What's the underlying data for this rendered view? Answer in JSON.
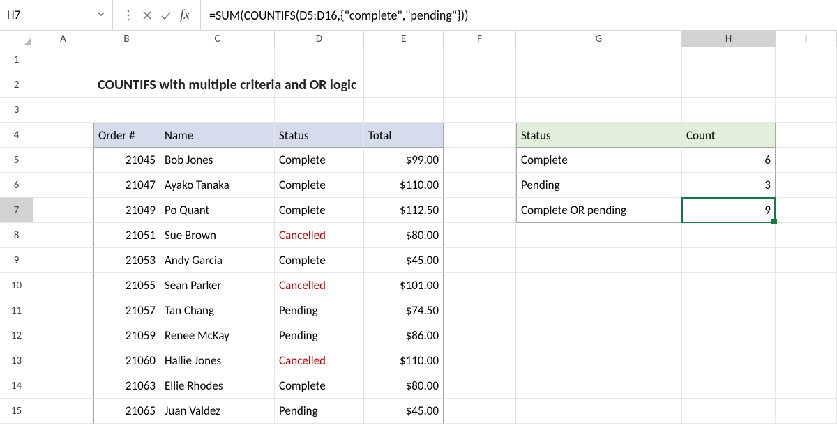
{
  "name_box": "H7",
  "formula": "=SUM(COUNTIFS(D5:D16,{\"complete\",\"pending\"}))",
  "columns": [
    "A",
    "B",
    "C",
    "D",
    "E",
    "F",
    "G",
    "H",
    "I"
  ],
  "rows": [
    "1",
    "2",
    "3",
    "4",
    "5",
    "6",
    "7",
    "8",
    "9",
    "10",
    "11",
    "12",
    "13",
    "14",
    "15"
  ],
  "title": "COUNTIFS with multiple criteria and OR logic",
  "main_table": {
    "headers": {
      "order": "Order #",
      "name": "Name",
      "status": "Status",
      "total": "Total"
    },
    "rows": [
      {
        "order": "21045",
        "name": "Bob Jones",
        "status": "Complete",
        "total": "$99.00",
        "cancelled": false
      },
      {
        "order": "21047",
        "name": "Ayako Tanaka",
        "status": "Complete",
        "total": "$110.00",
        "cancelled": false
      },
      {
        "order": "21049",
        "name": "Po Quant",
        "status": "Complete",
        "total": "$112.50",
        "cancelled": false
      },
      {
        "order": "21051",
        "name": "Sue Brown",
        "status": "Cancelled",
        "total": "$80.00",
        "cancelled": true
      },
      {
        "order": "21053",
        "name": "Andy Garcia",
        "status": "Complete",
        "total": "$45.00",
        "cancelled": false
      },
      {
        "order": "21055",
        "name": "Sean Parker",
        "status": "Cancelled",
        "total": "$101.00",
        "cancelled": true
      },
      {
        "order": "21057",
        "name": "Tan Chang",
        "status": "Pending",
        "total": "$74.50",
        "cancelled": false
      },
      {
        "order": "21059",
        "name": "Renee McKay",
        "status": "Pending",
        "total": "$86.00",
        "cancelled": false
      },
      {
        "order": "21060",
        "name": "Hallie Jones",
        "status": "Cancelled",
        "total": "$110.00",
        "cancelled": true
      },
      {
        "order": "21063",
        "name": "Ellie Rhodes",
        "status": "Complete",
        "total": "$80.00",
        "cancelled": false
      },
      {
        "order": "21065",
        "name": "Juan Valdez",
        "status": "Pending",
        "total": "$45.00",
        "cancelled": false
      }
    ]
  },
  "summary_table": {
    "headers": {
      "status": "Status",
      "count": "Count"
    },
    "rows": [
      {
        "status": "Complete",
        "count": "6"
      },
      {
        "status": "Pending",
        "count": "3"
      },
      {
        "status": "Complete OR pending",
        "count": "9"
      }
    ]
  },
  "selected_cell": "H7",
  "icons": {
    "dotsv": "⋮",
    "chevron": "⌄"
  },
  "colors": {
    "header_blue": "#d7dced",
    "header_green": "#e2efdb",
    "cancelled": "#c00000",
    "selection": "#107c41"
  }
}
